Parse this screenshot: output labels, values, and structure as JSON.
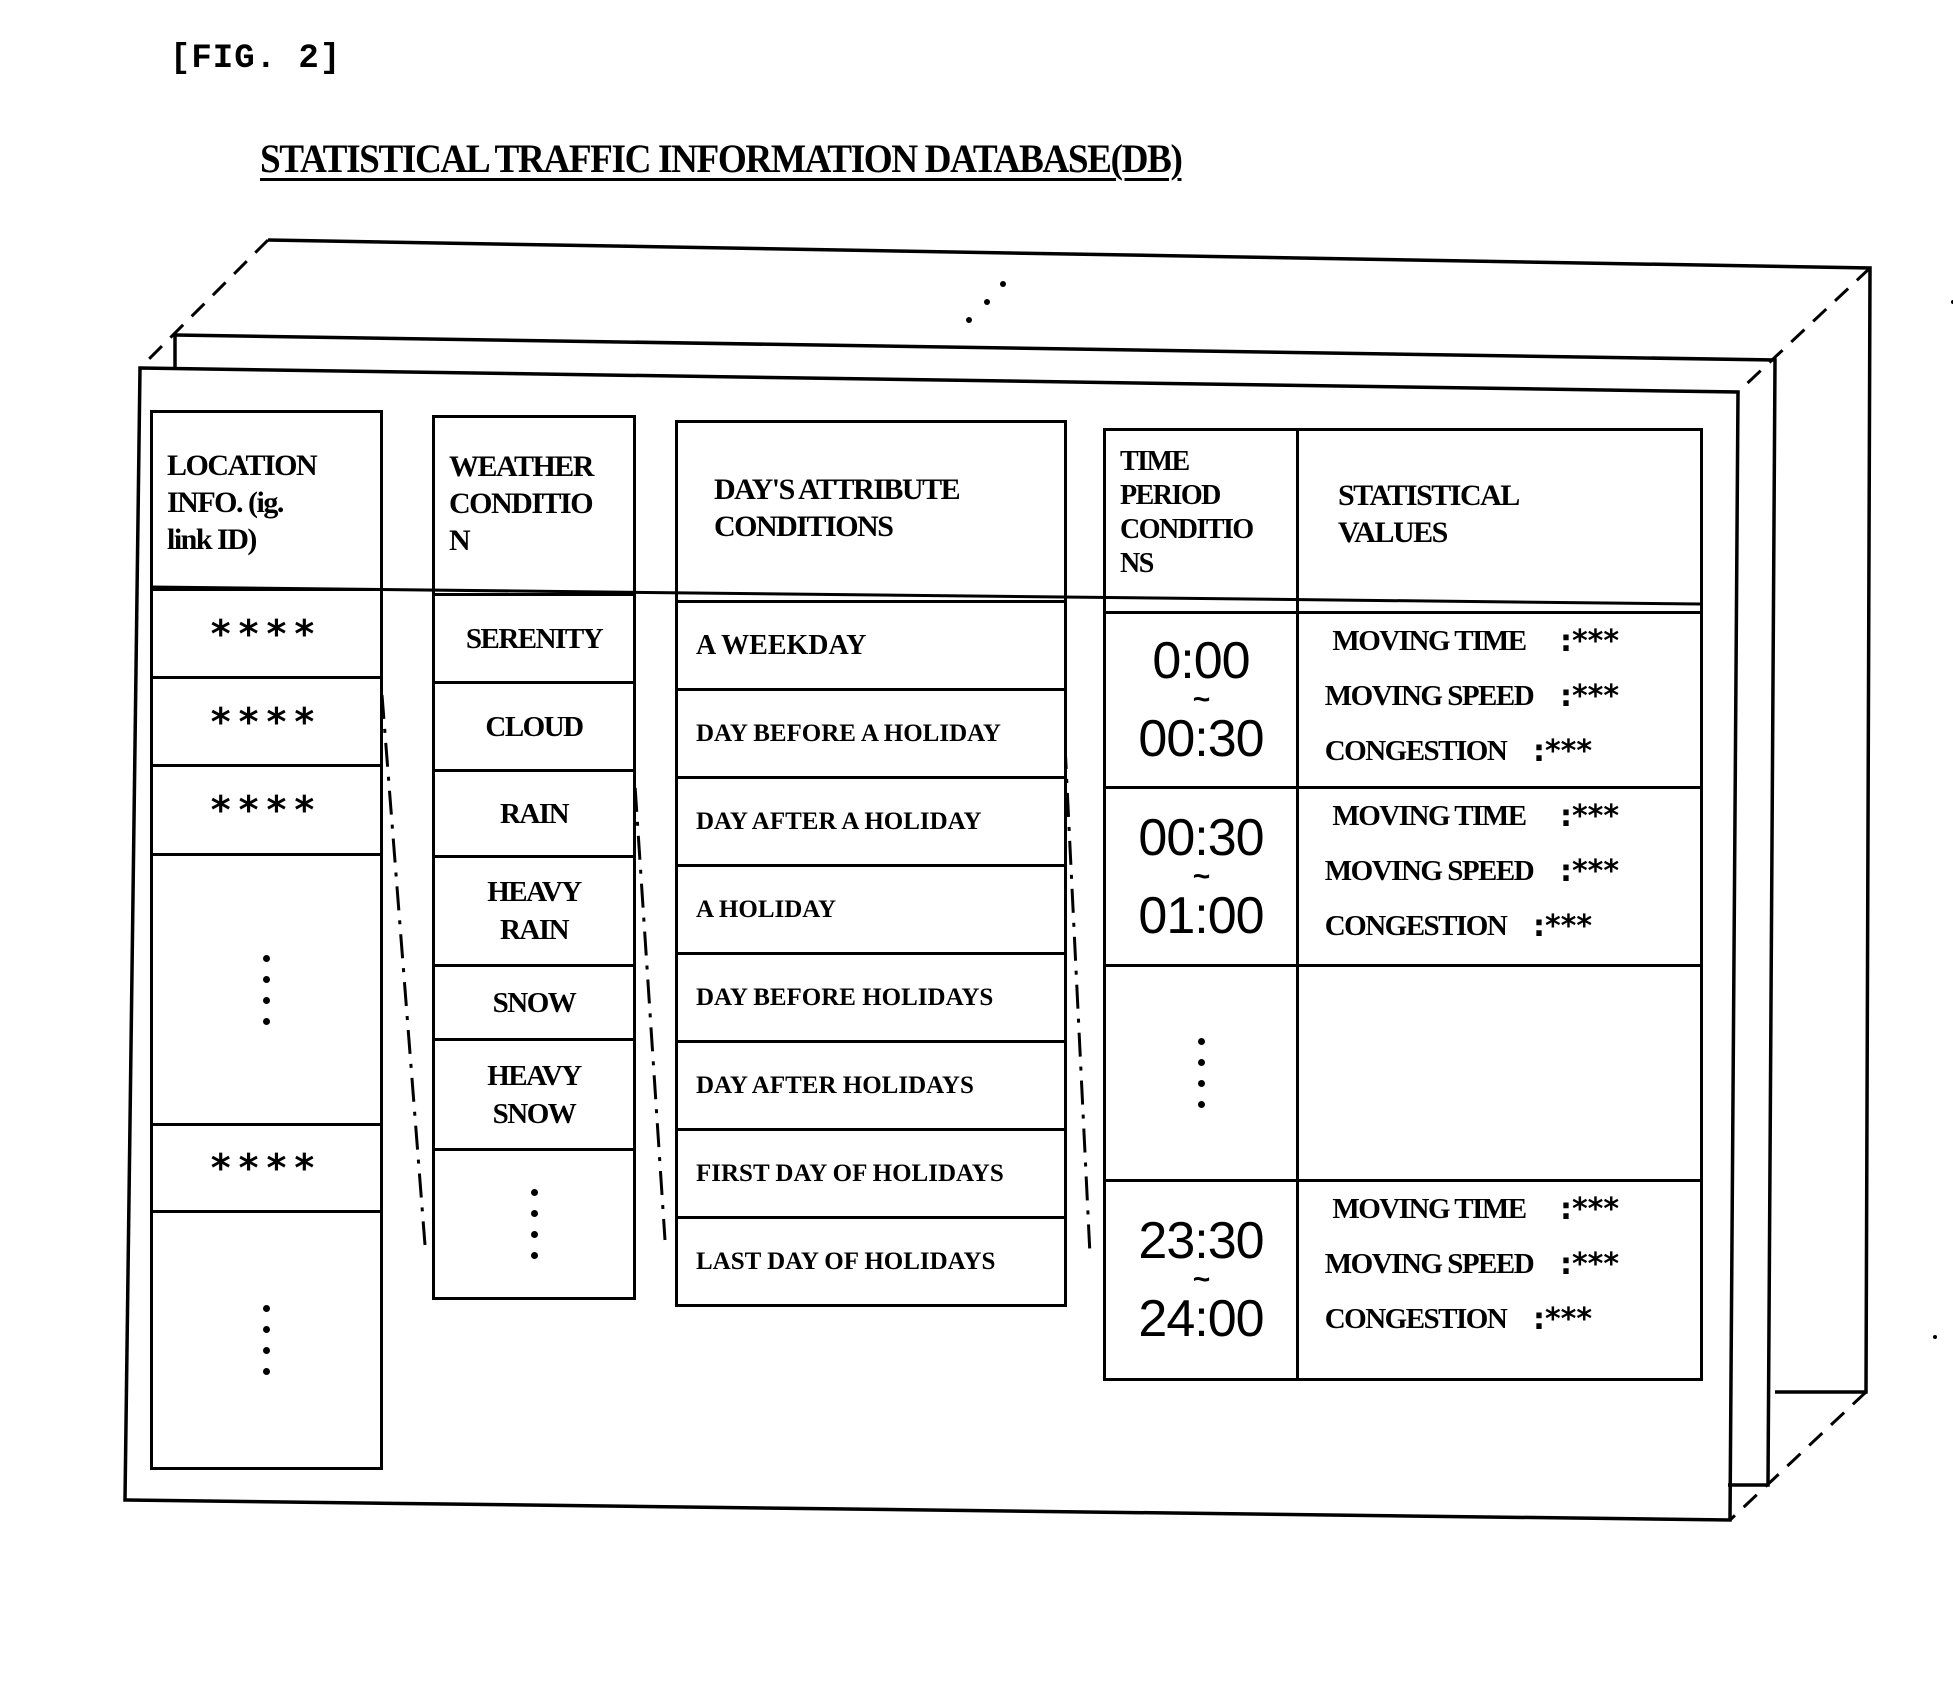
{
  "figure_label": "[FIG. 2]",
  "title": "STATISTICAL TRAFFIC INFORMATION DATABASE(DB)",
  "location_column": {
    "header": [
      "LOCATION",
      "INFO. (ig.",
      "link ID)"
    ],
    "rows": [
      "****",
      "****",
      "****",
      "⋮",
      "****",
      "⋮"
    ]
  },
  "weather_column": {
    "header": [
      "WEATHER",
      "CONDITIO",
      "N"
    ],
    "rows": [
      [
        "SERENITY"
      ],
      [
        "CLOUD"
      ],
      [
        "RAIN"
      ],
      [
        "HEAVY",
        "RAIN"
      ],
      [
        "SNOW"
      ],
      [
        "HEAVY",
        "SNOW"
      ],
      [
        "⋮"
      ]
    ]
  },
  "day_column": {
    "header": [
      "DAY'S ATTRIBUTE",
      "CONDITIONS"
    ],
    "rows": [
      "A WEEKDAY",
      "DAY BEFORE A HOLIDAY",
      "DAY AFTER A HOLIDAY",
      "A HOLIDAY",
      "DAY BEFORE HOLIDAYS",
      "DAY AFTER HOLIDAYS",
      "FIRST DAY OF HOLIDAYS",
      "LAST DAY OF HOLIDAYS"
    ]
  },
  "time_column": {
    "header": [
      "TIME",
      "PERIOD",
      "CONDITIO",
      "NS"
    ],
    "rows": [
      {
        "start": "0:00",
        "sep": "~",
        "end": "00:30"
      },
      {
        "start": "00:30",
        "sep": "~",
        "end": "01:00"
      },
      {
        "ellipsis": true
      },
      {
        "start": "23:30",
        "sep": "~",
        "end": "24:00"
      }
    ]
  },
  "stats_column": {
    "header": [
      "STATISTICAL",
      "VALUES"
    ],
    "rows": [
      [
        {
          "label": "MOVING TIME",
          "value": ":***"
        },
        {
          "label": "MOVING SPEED",
          "value": ":***"
        },
        {
          "label": "CONGESTION",
          "value": ":***"
        }
      ],
      [
        {
          "label": "MOVING TIME",
          "value": ":***"
        },
        {
          "label": "MOVING SPEED",
          "value": ":***"
        },
        {
          "label": "CONGESTION",
          "value": ":***"
        }
      ],
      [],
      [
        {
          "label": "MOVING TIME",
          "value": ":***"
        },
        {
          "label": "MOVING SPEED",
          "value": ":***"
        },
        {
          "label": "CONGESTION",
          "value": ":***"
        }
      ]
    ]
  },
  "stack_ellipsis": "⋰"
}
